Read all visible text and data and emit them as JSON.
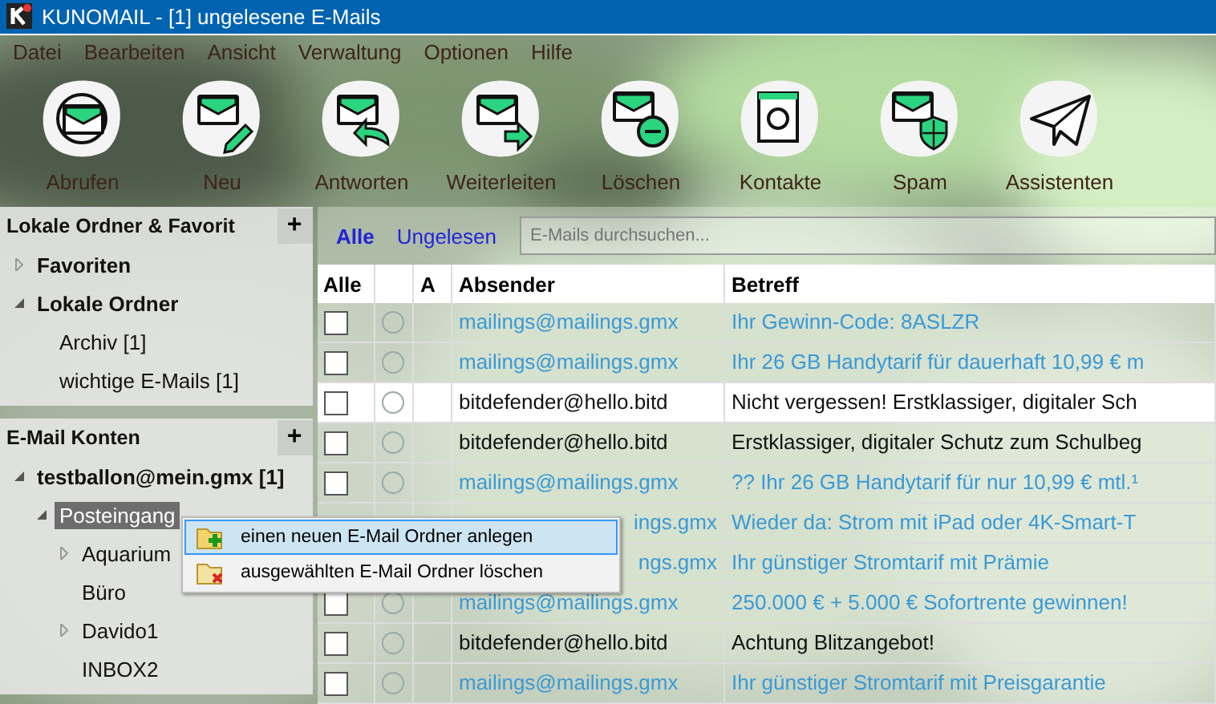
{
  "window": {
    "title": "KUNOMAIL - [1] ungelesene E-Mails"
  },
  "menu": [
    "Datei",
    "Bearbeiten",
    "Ansicht",
    "Verwaltung",
    "Optionen",
    "Hilfe"
  ],
  "toolbar": [
    {
      "label": "Abrufen"
    },
    {
      "label": "Neu"
    },
    {
      "label": "Antworten"
    },
    {
      "label": "Weiterleiten"
    },
    {
      "label": "Löschen"
    },
    {
      "label": "Kontakte"
    },
    {
      "label": "Spam"
    },
    {
      "label": "Assistenten"
    }
  ],
  "sidebar": {
    "sections": [
      {
        "title": "Lokale Ordner & Favorit",
        "add": "+",
        "items": [
          {
            "label": "Favoriten",
            "expanded": false,
            "selected": false
          },
          {
            "label": "Lokale Ordner",
            "expanded": true,
            "selected": false,
            "children": [
              {
                "label": "Archiv [1]",
                "selected": false
              },
              {
                "label": "wichtige E-Mails [1]",
                "selected": false
              }
            ]
          }
        ]
      },
      {
        "title": "E-Mail Konten",
        "add": "+",
        "items": [
          {
            "label": "testballon@mein.gmx [1]",
            "expanded": true,
            "selected": false,
            "children": [
              {
                "label": "Posteingang",
                "expanded": true,
                "selected": true,
                "children": [
                  {
                    "label": "Aquarium",
                    "expanded": false,
                    "selected": false
                  },
                  {
                    "label": "Büro",
                    "selected": false
                  },
                  {
                    "label": "Davido1",
                    "expanded": false,
                    "selected": false
                  },
                  {
                    "label": "INBOX2",
                    "selected": false
                  }
                ]
              }
            ]
          }
        ]
      }
    ]
  },
  "filters": [
    {
      "label": "Alle",
      "selected": true
    },
    {
      "label": "Ungelesen",
      "selected": false
    }
  ],
  "search": {
    "placeholder": "E-Mails durchsuchen..."
  },
  "table": {
    "columns": [
      {
        "kind": "check",
        "label": "Alle"
      },
      {
        "kind": "status"
      },
      {
        "kind": "attach",
        "label": "A"
      },
      {
        "kind": "sender",
        "label": "Absender"
      },
      {
        "kind": "subject",
        "label": "Betreff"
      }
    ],
    "rows": [
      {
        "checked": false,
        "unread": true,
        "selected": false,
        "sender": "mailings@mailings.gmx",
        "subject": "Ihr Gewinn-Code: 8ASLZR"
      },
      {
        "checked": false,
        "unread": true,
        "selected": false,
        "sender": "mailings@mailings.gmx",
        "subject": "Ihr 26 GB Handytarif für dauerhaft 10,99 € m"
      },
      {
        "checked": false,
        "unread": false,
        "selected": true,
        "sender": "bitdefender@hello.bitd",
        "subject": "Nicht vergessen! Erstklassiger, digitaler Sch"
      },
      {
        "checked": false,
        "unread": false,
        "selected": false,
        "sender": "bitdefender@hello.bitd",
        "subject": "Erstklassiger, digitaler Schutz zum Schulbeg"
      },
      {
        "checked": false,
        "unread": true,
        "selected": false,
        "sender": "mailings@mailings.gmx",
        "subject": "?? Ihr 26 GB Handytarif für nur 10,99 € mtl.¹"
      },
      {
        "unread": true,
        "selected": false,
        "covered": true,
        "sender": "ings.gmx",
        "subject": "Wieder da: Strom mit iPad oder 4K-Smart-T"
      },
      {
        "unread": true,
        "selected": false,
        "covered": true,
        "sender": "ngs.gmx",
        "subject": "Ihr günstiger Stromtarif mit Prämie"
      },
      {
        "checked": false,
        "unread": true,
        "selected": false,
        "sender": "mailings@mailings.gmx",
        "subject": "250.000 € + 5.000 € Sofortrente gewinnen!"
      },
      {
        "checked": false,
        "unread": false,
        "selected": false,
        "sender": "bitdefender@hello.bitd",
        "subject": "Achtung Blitzangebot!"
      },
      {
        "checked": false,
        "unread": true,
        "selected": false,
        "sender": "mailings@mailings.gmx",
        "subject": "Ihr günstiger Stromtarif mit Preisgarantie"
      }
    ]
  },
  "context_menu": {
    "items": [
      {
        "label": "einen neuen E-Mail Ordner anlegen",
        "kind": "add",
        "selected": true
      },
      {
        "label": "ausgewählten E-Mail Ordner löschen",
        "kind": "delete",
        "selected": false
      }
    ]
  }
}
